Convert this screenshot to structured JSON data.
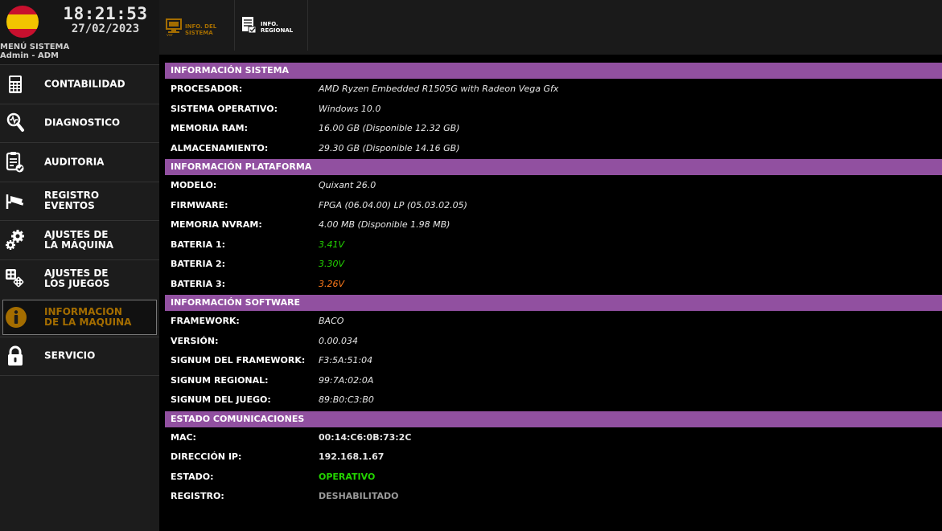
{
  "header": {
    "time": "18:21:53",
    "date": "27/02/2023",
    "menu_title": "MENÚ SISTEMA",
    "user": "Admin - ADM"
  },
  "sidebar": {
    "items": [
      {
        "label": "CONTABILIDAD",
        "icon": "calculator-icon"
      },
      {
        "label": "DIAGNOSTICO",
        "icon": "magnifier-icon"
      },
      {
        "label": "AUDITORIA",
        "icon": "clipboard-icon"
      },
      {
        "label": "REGISTRO\nEVENTOS",
        "icon": "camera-icon"
      },
      {
        "label": "AJUSTES DE\nLA MÁQUINA",
        "icon": "gears-icon"
      },
      {
        "label": "AJUSTES DE\nLOS JUEGOS",
        "icon": "dice-icon"
      },
      {
        "label": "INFORMACION\nDE LA MAQUINA",
        "icon": "info-icon"
      },
      {
        "label": "SERVICIO",
        "icon": "lock-icon"
      }
    ]
  },
  "topbar": {
    "tabs": [
      {
        "label": "INFO. DEL\nSISTEMA",
        "icon": "system-info-icon"
      },
      {
        "label": "INFO.\nREGIONAL",
        "icon": "regional-info-icon"
      }
    ]
  },
  "sections": {
    "sistema": {
      "title": "INFORMACIÓN SISTEMA",
      "rows": [
        {
          "k": "PROCESADOR:",
          "v": "AMD Ryzen Embedded R1505G with Radeon Vega Gfx"
        },
        {
          "k": "SISTEMA OPERATIVO:",
          "v": "Windows 10.0"
        },
        {
          "k": "MEMORIA RAM:",
          "v": "16.00 GB (Disponible 12.32 GB)"
        },
        {
          "k": "ALMACENAMIENTO:",
          "v": "29.30 GB (Disponible 14.16 GB)"
        }
      ]
    },
    "plataforma": {
      "title": "INFORMACIÓN PLATAFORMA",
      "rows": [
        {
          "k": "MODELO:",
          "v": "Quixant 26.0"
        },
        {
          "k": "FIRMWARE:",
          "v": "FPGA (06.04.00) LP (05.03.02.05)"
        },
        {
          "k": "MEMORIA NVRAM:",
          "v": "4.00 MB (Disponible 1.98 MB)"
        },
        {
          "k": "BATERIA 1:",
          "v": "3.41V"
        },
        {
          "k": "BATERIA 2:",
          "v": "3.30V"
        },
        {
          "k": "BATERIA 3:",
          "v": "3.26V"
        }
      ]
    },
    "software": {
      "title": "INFORMACIÓN SOFTWARE",
      "rows": [
        {
          "k": "FRAMEWORK:",
          "v": "BACO"
        },
        {
          "k": "VERSIÓN:",
          "v": "0.00.034"
        },
        {
          "k": "SIGNUM DEL FRAMEWORK:",
          "v": "F3:5A:51:04"
        },
        {
          "k": "SIGNUM REGIONAL:",
          "v": "99:7A:02:0A"
        },
        {
          "k": "SIGNUM DEL JUEGO:",
          "v": "89:B0:C3:B0"
        }
      ]
    },
    "comunicaciones": {
      "title": "ESTADO COMUNICACIONES",
      "rows": [
        {
          "k": "MAC:",
          "v": "00:14:C6:0B:73:2C"
        },
        {
          "k": "DIRECCIÓN IP:",
          "v": "192.168.1.67"
        },
        {
          "k": "ESTADO:",
          "v": "OPERATIVO"
        },
        {
          "k": "REGISTRO:",
          "v": "DESHABILITADO"
        }
      ]
    }
  },
  "colors": {
    "section_header": "#9150a0",
    "active_text": "#a46d00",
    "ok_green": "#23d400",
    "warn_orange": "#ff7a1a",
    "disabled_gray": "#9a9a9a"
  }
}
